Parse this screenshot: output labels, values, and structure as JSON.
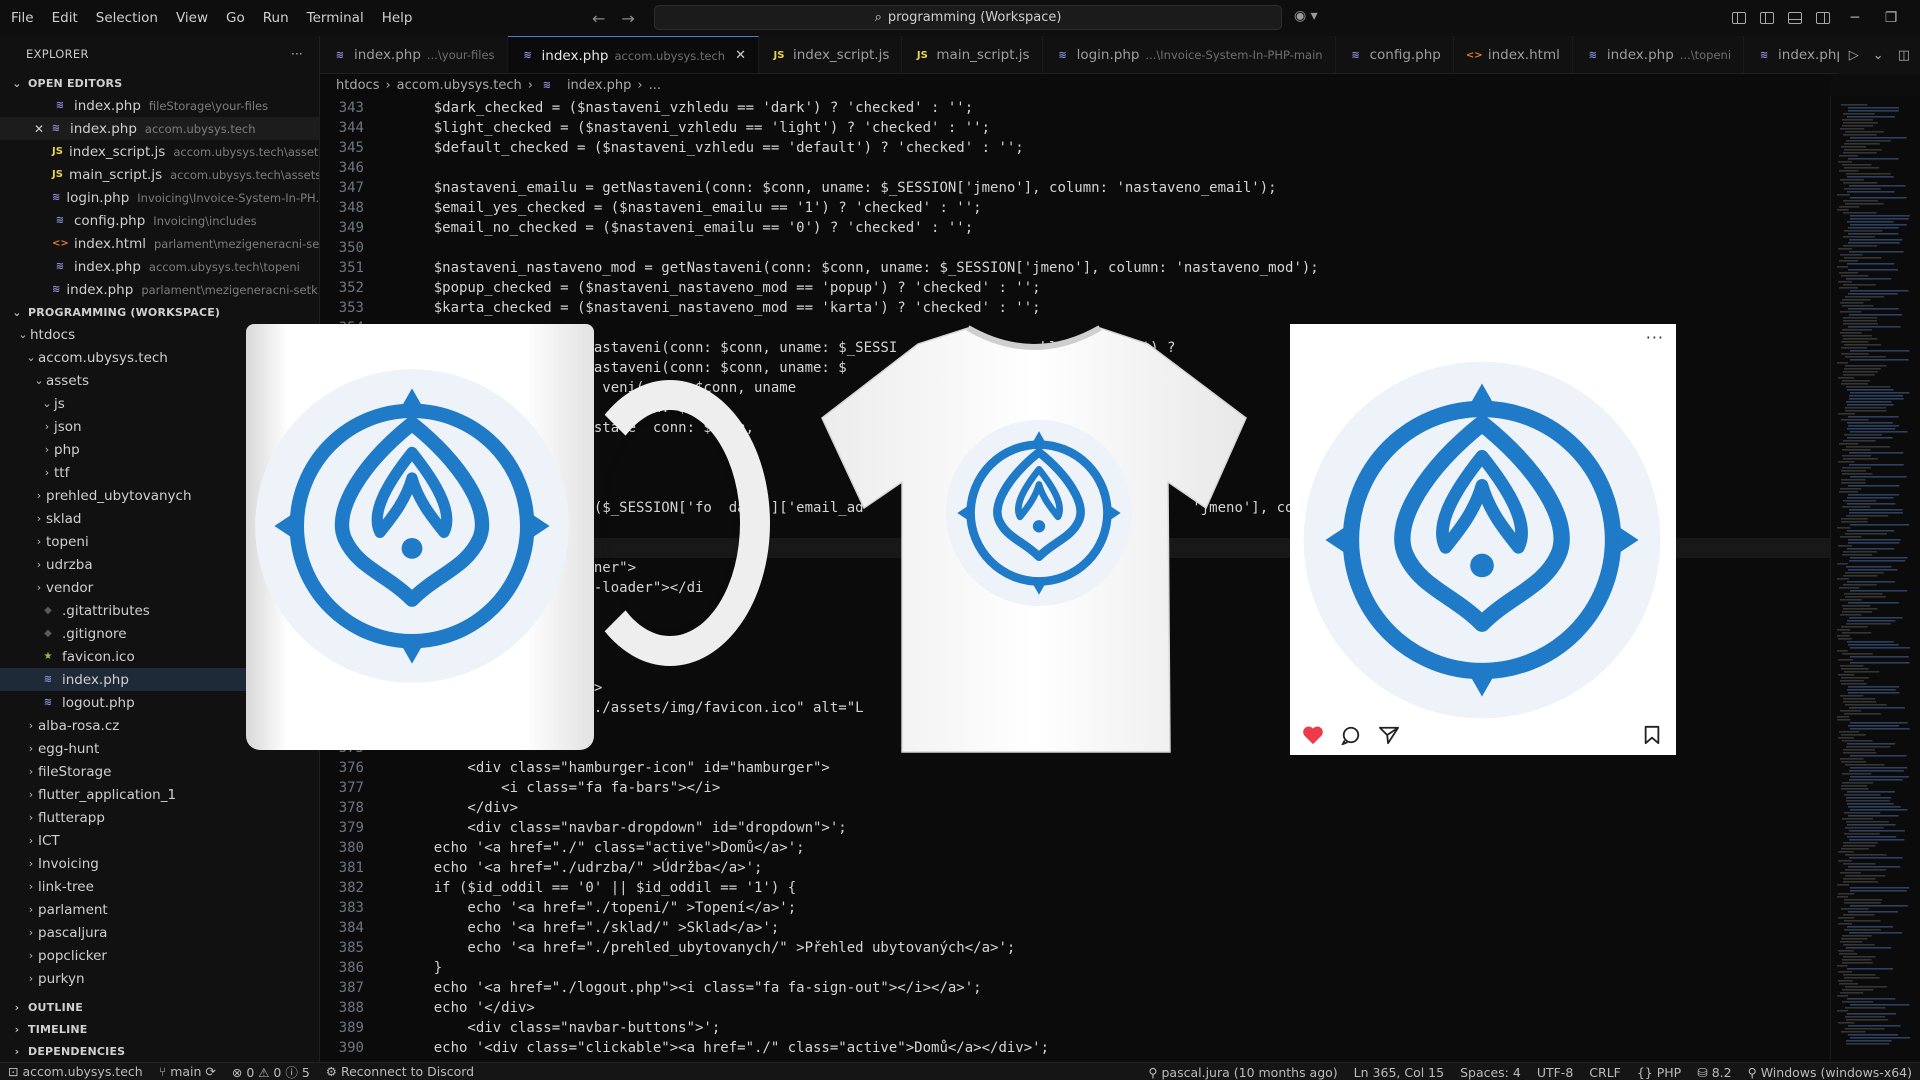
{
  "menu": [
    "File",
    "Edit",
    "Selection",
    "View",
    "Go",
    "Run",
    "Terminal",
    "Help"
  ],
  "command_center": {
    "label": "programming (Workspace)"
  },
  "explorer": {
    "title": "EXPLORER",
    "more": "···",
    "open_editors_title": "OPEN EDITORS",
    "open_editors": [
      {
        "icon": "php",
        "name": "index.php",
        "path": "fileStorage\\your-files"
      },
      {
        "icon": "php",
        "name": "index.php",
        "path": "accom.ubysys.tech"
      },
      {
        "icon": "js",
        "name": "index_script.js",
        "path": "accom.ubysys.tech\\assets\\js"
      },
      {
        "icon": "js",
        "name": "main_script.js",
        "path": "accom.ubysys.tech\\assets\\js"
      },
      {
        "icon": "php",
        "name": "login.php",
        "path": "Invoicing\\Invoice-System-In-PH..."
      },
      {
        "icon": "php",
        "name": "config.php",
        "path": "Invoicing\\includes"
      },
      {
        "icon": "html",
        "name": "index.html",
        "path": "parlament\\mezigeneracni-setk..."
      },
      {
        "icon": "php",
        "name": "index.php",
        "path": "accom.ubysys.tech\\topeni"
      },
      {
        "icon": "php",
        "name": "index.php",
        "path": "parlament\\mezigeneracni-setk..."
      }
    ],
    "workspace_title": "PROGRAMMING (WORKSPACE)",
    "tree": [
      {
        "label": "htdocs",
        "type": "folder-open",
        "depth": 0
      },
      {
        "label": "accom.ubysys.tech",
        "type": "folder-open",
        "depth": 1
      },
      {
        "label": "assets",
        "type": "folder-open",
        "depth": 2
      },
      {
        "label": "js",
        "type": "folder-open",
        "depth": 3
      },
      {
        "label": "json",
        "type": "folder",
        "depth": 3
      },
      {
        "label": "php",
        "type": "folder",
        "depth": 3
      },
      {
        "label": "ttf",
        "type": "folder",
        "depth": 3
      },
      {
        "label": "prehled_ubytovanych",
        "type": "folder",
        "depth": 2
      },
      {
        "label": "sklad",
        "type": "folder",
        "depth": 2
      },
      {
        "label": "topeni",
        "type": "folder",
        "depth": 2
      },
      {
        "label": "udrzba",
        "type": "folder",
        "depth": 2
      },
      {
        "label": "vendor",
        "type": "folder",
        "depth": 2
      },
      {
        "label": ".gitattributes",
        "type": "git",
        "depth": 2
      },
      {
        "label": ".gitignore",
        "type": "git",
        "depth": 2
      },
      {
        "label": "favicon.ico",
        "type": "ico",
        "depth": 2
      },
      {
        "label": "index.php",
        "type": "php",
        "depth": 2
      },
      {
        "label": "logout.php",
        "type": "php",
        "depth": 2
      },
      {
        "label": "alba-rosa.cz",
        "type": "folder",
        "depth": 1
      },
      {
        "label": "egg-hunt",
        "type": "folder",
        "depth": 1
      },
      {
        "label": "fileStorage",
        "type": "folder",
        "depth": 1
      },
      {
        "label": "flutter_application_1",
        "type": "folder",
        "depth": 1
      },
      {
        "label": "flutterapp",
        "type": "folder",
        "depth": 1
      },
      {
        "label": "ICT",
        "type": "folder",
        "depth": 1
      },
      {
        "label": "Invoicing",
        "type": "folder",
        "depth": 1
      },
      {
        "label": "link-tree",
        "type": "folder",
        "depth": 1
      },
      {
        "label": "parlament",
        "type": "folder",
        "depth": 1
      },
      {
        "label": "pascaljura",
        "type": "folder",
        "depth": 1
      },
      {
        "label": "popclicker",
        "type": "folder",
        "depth": 1
      },
      {
        "label": "purkyn",
        "type": "folder",
        "depth": 1
      }
    ],
    "bottom_sections": [
      "OUTLINE",
      "TIMELINE",
      "DEPENDENCIES"
    ]
  },
  "tabs": [
    {
      "icon": "php",
      "name": "index.php",
      "path": "...\\your-files"
    },
    {
      "icon": "php",
      "name": "index.php",
      "path": "accom.ubysys.tech",
      "active": true
    },
    {
      "icon": "js",
      "name": "index_script.js",
      "path": ""
    },
    {
      "icon": "js",
      "name": "main_script.js",
      "path": ""
    },
    {
      "icon": "php",
      "name": "login.php",
      "path": "...\\Invoice-System-In-PHP-main"
    },
    {
      "icon": "php",
      "name": "config.php",
      "path": ""
    },
    {
      "icon": "html",
      "name": "index.html",
      "path": ""
    },
    {
      "icon": "php",
      "name": "index.php",
      "path": "...\\topeni"
    },
    {
      "icon": "php",
      "name": "index.php",
      "path": ""
    }
  ],
  "breadcrumb": [
    "htdocs",
    "accom.ubysys.tech",
    "index.php",
    "..."
  ],
  "code": [
    {
      "n": "343",
      "t": "    $dark_checked = ($nastaveni_vzhledu == 'dark') ? 'checked' : '';"
    },
    {
      "n": "344",
      "t": "    $light_checked = ($nastaveni_vzhledu == 'light') ? 'checked' : '';"
    },
    {
      "n": "345",
      "t": "    $default_checked = ($nastaveni_vzhledu == 'default') ? 'checked' : '';"
    },
    {
      "n": "346",
      "t": ""
    },
    {
      "n": "347",
      "t": "    $nastaveni_emailu = getNastaveni(conn: $conn, uname: $_SESSION['jmeno'], column: 'nastaveno_email');"
    },
    {
      "n": "348",
      "t": "    $email_yes_checked = ($nastaveni_emailu == '1') ? 'checked' : '';"
    },
    {
      "n": "349",
      "t": "    $email_no_checked = ($nastaveni_emailu == '0') ? 'checked' : '';"
    },
    {
      "n": "350",
      "t": ""
    },
    {
      "n": "351",
      "t": "    $nastaveni_nastaveno_mod = getNastaveni(conn: $conn, uname: $_SESSION['jmeno'], column: 'nastaveno_mod');"
    },
    {
      "n": "352",
      "t": "    $popup_checked = ($nastaveni_nastaveno_mod == 'popup') ? 'checked' : '';"
    },
    {
      "n": "353",
      "t": "    $karta_checked = ($nastaveni_nastaveno_mod == 'karta') ? 'checked' : '';"
    },
    {
      "n": "354",
      "t": ""
    },
    {
      "n": "355",
      "t": "                  (getNastaveni(conn: $conn, uname: $_SESSI                 klad') == '1') ?"
    },
    {
      "n": "356",
      "t": "                  (getNastaveni(conn: $conn, uname: $                        eni') == '1')"
    },
    {
      "n": "357",
      "t": "                        veni(conn: $conn, uname                              == '1')"
    },
    {
      "n": "358",
      "t": "                          (conn: $conn,                                       == '1"
    },
    {
      "n": "359",
      "t": "                  getNastave  conn: $conn,                                   ubytova"
    },
    {
      "n": "360",
      "t": ""
    },
    {
      "n": "361",
      "t": ""
    },
    {
      "n": "362",
      "t": ""
    },
    {
      "n": "363",
      "t": "                  isset($_SESSION['fo  data']['email_ad                    ['email_address'   'jmeno'], column: '"
    },
    {
      "n": "364",
      "t": ""
    },
    {
      "n": "365",
      "t": ""
    },
    {
      "n": "366",
      "t": "                  ontainer\">"
    },
    {
      "n": "367",
      "t": "                  ustom-loader\"></di"
    },
    {
      "n": "368",
      "t": ""
    },
    {
      "n": "369",
      "t": "                   >"
    },
    {
      "n": "370",
      "t": "                   \">"
    },
    {
      "n": "371",
      "t": ""
    },
    {
      "n": "372",
      "t": "                  itle\">"
    },
    {
      "n": "373",
      "t": "                  src=\"./assets/img/favicon.ico\" alt=\"L"
    },
    {
      "n": "374",
      "t": ""
    },
    {
      "n": "375",
      "t": ""
    },
    {
      "n": "376",
      "t": "        <div class=\"hamburger-icon\" id=\"hamburger\">"
    },
    {
      "n": "377",
      "t": "            <i class=\"fa fa-bars\"></i>"
    },
    {
      "n": "378",
      "t": "        </div>"
    },
    {
      "n": "379",
      "t": "        <div class=\"navbar-dropdown\" id=\"dropdown\">';"
    },
    {
      "n": "380",
      "t": "    echo '<a href=\"./\" class=\"active\">Domů</a>';"
    },
    {
      "n": "381",
      "t": "    echo '<a href=\"./udrzba/\" >Údržba</a>';"
    },
    {
      "n": "382",
      "t": "    if ($id_oddil == '0' || $id_oddil == '1') {"
    },
    {
      "n": "383",
      "t": "        echo '<a href=\"./topeni/\" >Topení</a>';"
    },
    {
      "n": "384",
      "t": "        echo '<a href=\"./sklad/\" >Sklad</a>';"
    },
    {
      "n": "385",
      "t": "        echo '<a href=\"./prehled_ubytovanych/\" >Přehled ubytovaných</a>';"
    },
    {
      "n": "386",
      "t": "    }"
    },
    {
      "n": "387",
      "t": "    echo '<a href=\"./logout.php\"><i class=\"fa fa-sign-out\"></i></a>';"
    },
    {
      "n": "388",
      "t": "    echo '</div>"
    },
    {
      "n": "389",
      "t": "        <div class=\"navbar-buttons\">';"
    },
    {
      "n": "390",
      "t": "    echo '<div class=\"clickable\"><a href=\"./\" class=\"active\">Domů</a></div>';"
    }
  ],
  "statusbar": {
    "remote": "accom.ubysys.tech",
    "branch": "main",
    "problems": "⊗ 0  ⚠ 0  ⓘ 5",
    "discord": "Reconnect to Discord",
    "blame": "pascal.jura (10 months ago)",
    "position": "Ln 365, Col 15",
    "spaces": "Spaces: 4",
    "encoding": "UTF-8",
    "eol": "CRLF",
    "language": "PHP",
    "version": "8.2",
    "platform": "Windows (windows-x64)"
  },
  "colors": {
    "logo_blue": "#1f7ac7",
    "logo_bg": "#eef3fa",
    "heart_red": "#ed3b4a"
  }
}
